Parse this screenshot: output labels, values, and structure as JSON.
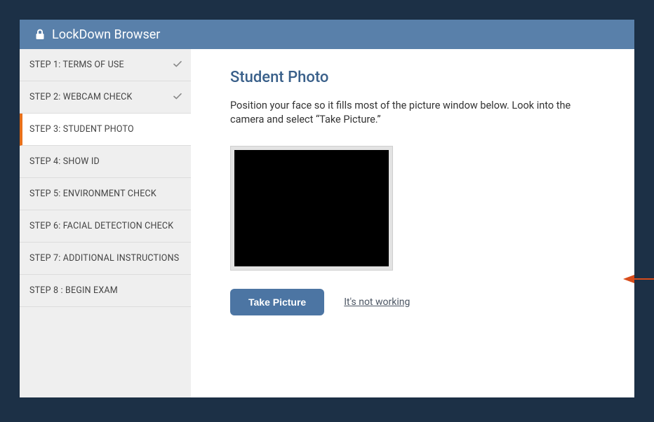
{
  "header": {
    "title": "LockDown Browser"
  },
  "sidebar": {
    "steps": [
      {
        "label": "STEP 1: TERMS OF USE",
        "done": true,
        "active": false
      },
      {
        "label": "STEP 2: WEBCAM CHECK",
        "done": true,
        "active": false
      },
      {
        "label": "STEP 3: STUDENT PHOTO",
        "done": false,
        "active": true
      },
      {
        "label": "STEP 4: SHOW ID",
        "done": false,
        "active": false
      },
      {
        "label": "STEP 5: ENVIRONMENT CHECK",
        "done": false,
        "active": false
      },
      {
        "label": "STEP 6: FACIAL DETECTION CHECK",
        "done": false,
        "active": false
      },
      {
        "label": "STEP 7: ADDITIONAL INSTRUCTIONS",
        "done": false,
        "active": false
      },
      {
        "label": "STEP 8 : BEGIN EXAM",
        "done": false,
        "active": false
      }
    ]
  },
  "main": {
    "title": "Student Photo",
    "instructions": "Position your face so it fills most of the picture window below. Look into the camera and select “Take Picture.”",
    "take_picture_label": "Take Picture",
    "not_working_label": "It's not working"
  },
  "colors": {
    "accent_orange": "#e8701a",
    "arrow": "#d84c1b",
    "header_bg": "#5980aa",
    "button_bg": "#4c75a3",
    "title_text": "#3a608a"
  }
}
